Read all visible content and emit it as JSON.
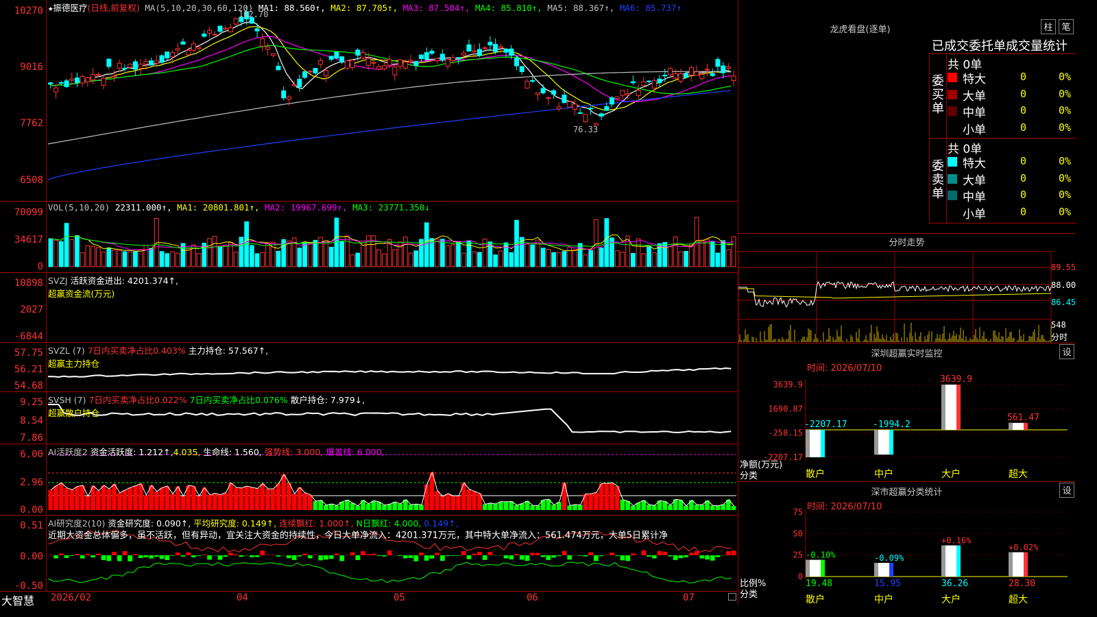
{
  "stock": {
    "star": "★",
    "name": "振德医疗",
    "mode": "(日线,前复权)"
  },
  "main": {
    "ma_title": "MA(5,10,20,30,60,120)",
    "ma": [
      {
        "label": "MA1: 88.560↑,",
        "color": "#ffffff"
      },
      {
        "label": "MA2: 87.705↑,",
        "color": "#ffff00"
      },
      {
        "label": "MA3: 87.504↑,",
        "color": "#ff00ff"
      },
      {
        "label": "MA4: 85.810↑,",
        "color": "#00ff00"
      },
      {
        "label": "MA5: 88.367↑,",
        "color": "#c0c0c0"
      },
      {
        "label": "MA6: 85.737↑",
        "color": "#2040ff"
      }
    ],
    "ylabels": [
      "10270",
      "9016",
      "7762",
      "6508"
    ],
    "high_mark": "102.70",
    "low_mark": "76.33"
  },
  "vol": {
    "title": "VOL(5,10,20)",
    "value": "22311.000↑,",
    "ma": [
      {
        "label": "MA1: 20801.801↑,",
        "color": "#ffff00"
      },
      {
        "label": "MA2: 19967.699↑,",
        "color": "#ff00ff"
      },
      {
        "label": "MA3: 23771.350↓",
        "color": "#00ff00"
      }
    ],
    "ylabels": [
      "70099",
      "34617",
      "0"
    ]
  },
  "svzj": {
    "title": "SVZJ",
    "subtitle": "活跃资金进出: 4201.374↑,",
    "line2": "超赢资金流(万元)",
    "ylabels": [
      "10898",
      "2027",
      "-6844"
    ]
  },
  "svzl": {
    "title": "SVZL (7)",
    "p1": "7日内买卖净占比0.403%",
    "p2": "主力持仓: 57.567↑,",
    "line2": "超赢主力持仓",
    "ylabels": [
      "57.75",
      "56.21",
      "54.68"
    ]
  },
  "svsh": {
    "title": "SVSH (7)",
    "p1": "7日内买卖净占比0.022%",
    "p2": "7日内买卖净占比0.076%",
    "p3": "散户持仓: 7.979↓,",
    "line2": "超赢散户持仓",
    "ylabels": [
      "9.25",
      "8.54",
      "7.86"
    ]
  },
  "ai1": {
    "title": "AI活跃度2",
    "p1": "资金活跃度: 1.212↑,",
    "p2": "4.035,",
    "p3": "生命线: 1.560,",
    "p4": "强势线: 3.000,",
    "p5": "爆发线: 6.000,",
    "ylabels": [
      "6.00",
      "2.96",
      "0.00"
    ]
  },
  "ai2": {
    "title": "AI研究度2(10)",
    "p1": "资金研究度: 0.090↑,",
    "p2": "平均研究度: 0.149↑,",
    "p3": "连续飘红: 1.000↑,",
    "p4": "N日飘红: 4.000,",
    "p5": "0.149↑,",
    "comment": "近期大资金总体偏多，虽不活跃，但有异动，宜关注大资金的持续性，今日大单净流入：4201.371万元，其中特大单净流入：561.474万元，大单5日累计净",
    "ylabels": [
      "0.51",
      "0.00",
      "-0.50"
    ]
  },
  "bottom": {
    "logo": "大智慧",
    "dates": [
      "2026/02",
      "04",
      "05",
      "06",
      "07"
    ]
  },
  "lhb": {
    "title": "龙虎看盘(逐单)",
    "btn1": "柱",
    "btn2": "笔",
    "subtitle": "已成交委托单成交量统计",
    "buy_label": "委买单",
    "sell_label": "委卖单",
    "buy_total": "共 0单",
    "sell_total": "共 0单",
    "buy_rows": [
      {
        "name": "特大",
        "v": "0",
        "p": "0%",
        "color": "#ff0000"
      },
      {
        "name": "大单",
        "v": "0",
        "p": "0%",
        "color": "#a00000"
      },
      {
        "name": "中单",
        "v": "0",
        "p": "0%",
        "color": "#600000"
      },
      {
        "name": "小单",
        "v": "0",
        "p": "0%",
        "color": ""
      }
    ],
    "sell_rows": [
      {
        "name": "特大",
        "v": "0",
        "p": "0%",
        "color": "#00ffff"
      },
      {
        "name": "大单",
        "v": "0",
        "p": "0%",
        "color": "#008c8c"
      },
      {
        "name": "中单",
        "v": "0",
        "p": "0%",
        "color": "#006c6c"
      },
      {
        "name": "小单",
        "v": "0",
        "p": "0%",
        "color": ""
      }
    ]
  },
  "fenshi": {
    "title": "分时走势",
    "p_hi": "89.55",
    "p_mid": "88.00",
    "p_lo": "86.45",
    "vol": "548",
    "unit": "分时"
  },
  "sz1": {
    "title": "深圳超赢实时监控",
    "btn": "设",
    "date": "时间: 2026/07/10",
    "ylabels": [
      "3639.9",
      "1690.87",
      "-258.15",
      "-2207.17"
    ],
    "unit": "净额(万元)",
    "cat_label": "分类",
    "bars": [
      {
        "cat": "散户",
        "value": -2207.17,
        "label": "-2207.17",
        "color": "#00ffff"
      },
      {
        "cat": "中户",
        "value": -1994.2,
        "label": "-1994.2",
        "color": "#00ffff"
      },
      {
        "cat": "大户",
        "value": 3639.9,
        "label": "3639.9",
        "color": "#ff3333"
      },
      {
        "cat": "超大",
        "value": 561.47,
        "label": "561.47",
        "color": "#ff3333"
      }
    ]
  },
  "sz2": {
    "title": "深市超赢分类统计",
    "btn": "设",
    "date": "时间: 2026/07/10",
    "ylabels": [
      "75",
      "50",
      "25",
      "0"
    ],
    "unit": "比例%",
    "cat_label": "分类",
    "bars": [
      {
        "cat": "散户",
        "value": 19.48,
        "label": "19.48",
        "chg": "-0.10%",
        "color": "#00ff00",
        "chgcolor": "#00ff00"
      },
      {
        "cat": "中户",
        "value": 15.95,
        "label": "15.95",
        "chg": "-0.09%",
        "color": "#2040ff",
        "chgcolor": "#00ffff"
      },
      {
        "cat": "大户",
        "value": 36.26,
        "label": "36.26",
        "chg": "+0.16%",
        "color": "#00ffff",
        "chgcolor": "#ff3333"
      },
      {
        "cat": "超大",
        "value": 28.3,
        "label": "28.30",
        "chg": "+0.02%",
        "color": "#ff3333",
        "chgcolor": "#ff3333"
      }
    ]
  }
}
